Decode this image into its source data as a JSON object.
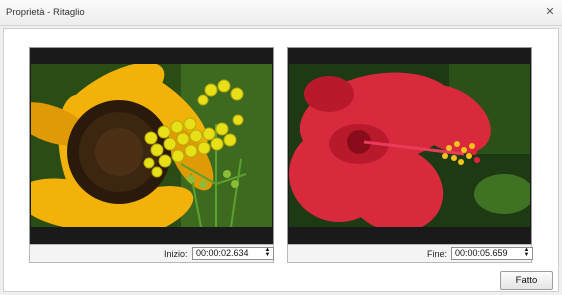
{
  "window": {
    "title": "Proprietà - Ritaglio",
    "close_glyph": "✕"
  },
  "start_panel": {
    "image": "sunflower-with-yellow-buttons",
    "label": "Inizio:",
    "time": "00:00:02.634"
  },
  "end_panel": {
    "image": "red-hibiscus-flower",
    "label": "Fine:",
    "time": "00:00:05.659"
  },
  "spinner_glyph": "▲▼",
  "done_button": {
    "label": "Fatto"
  }
}
